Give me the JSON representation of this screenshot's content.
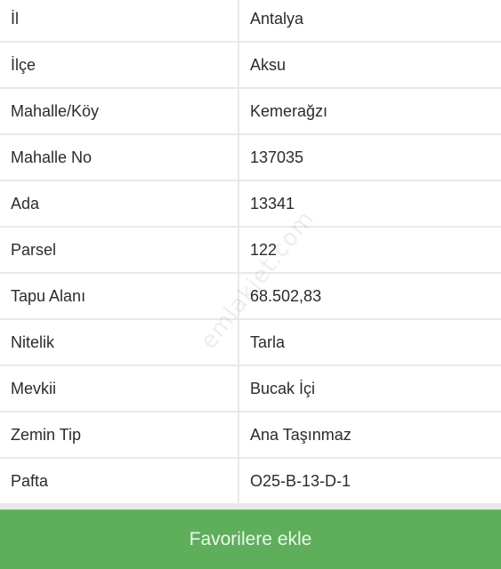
{
  "details": {
    "rows": [
      {
        "label": "İl",
        "value": "Antalya"
      },
      {
        "label": "İlçe",
        "value": "Aksu"
      },
      {
        "label": "Mahalle/Köy",
        "value": "Kemerağzı"
      },
      {
        "label": "Mahalle No",
        "value": "137035"
      },
      {
        "label": "Ada",
        "value": "13341"
      },
      {
        "label": "Parsel",
        "value": "122"
      },
      {
        "label": "Tapu Alanı",
        "value": "68.502,83"
      },
      {
        "label": "Nitelik",
        "value": "Tarla"
      },
      {
        "label": "Mevkii",
        "value": "Bucak İçi"
      },
      {
        "label": "Zemin Tip",
        "value": "Ana Taşınmaz"
      },
      {
        "label": "Pafta",
        "value": "O25-B-13-D-1"
      }
    ]
  },
  "watermark": "emlakjet.com",
  "actions": {
    "favorite_label": "Favorilere ekle"
  },
  "colors": {
    "button_bg": "#5fae5c",
    "divider": "#e9e9e9"
  }
}
